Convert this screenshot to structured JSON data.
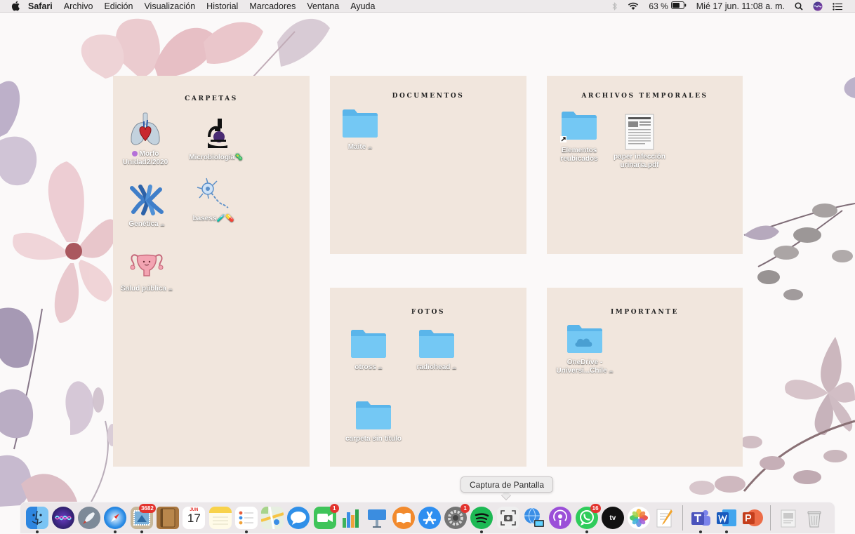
{
  "menubar": {
    "app_name": "Safari",
    "items": [
      "Archivo",
      "Edición",
      "Visualización",
      "Historial",
      "Marcadores",
      "Ventana",
      "Ayuda"
    ],
    "battery_percent": "63 %",
    "datetime": "Mié 17 jun.  11:08 a. m.",
    "status_icons": [
      "bluetooth-icon",
      "wifi-icon",
      "battery-icon",
      "spotlight-search-icon",
      "siri-icon",
      "control-center-icon"
    ]
  },
  "panels": {
    "carpetas": {
      "title": "CARPETAS",
      "items": [
        {
          "label_line1": "Morfo",
          "label_line2": "Unidad2/2020",
          "icon": "lungs-heart-icon",
          "tag_color": "#b470d8"
        },
        {
          "label": "Microbiología",
          "suffix": "🦠",
          "icon": "microscope-icon"
        },
        {
          "label": "Genética",
          "icon": "chromosome-icon",
          "cloud": "☁"
        },
        {
          "label": "basess",
          "suffix": "🧪💊",
          "icon": "neuron-icon"
        },
        {
          "label": "Salud pública",
          "icon": "uterus-icon",
          "cloud": "☁"
        }
      ]
    },
    "documentos": {
      "title": "DOCUMENTOS",
      "items": [
        {
          "label": "Maite",
          "icon": "folder-icon",
          "cloud": "☁"
        }
      ]
    },
    "archivos_temporales": {
      "title": "ARCHIVOS TEMPORALES",
      "items": [
        {
          "label_line1": "Elementos",
          "label_line2": "reubicados",
          "icon": "folder-alias-icon"
        },
        {
          "label_line1": "paper infección",
          "label_line2": "urinaria.pdf",
          "icon": "pdf-document-icon"
        }
      ]
    },
    "fotos": {
      "title": "FOTOS",
      "items": [
        {
          "label": "otross",
          "icon": "folder-icon",
          "cloud": "☁"
        },
        {
          "label": "radiohead",
          "icon": "folder-icon",
          "cloud": "☁"
        },
        {
          "label": "carpeta sin título",
          "icon": "folder-icon"
        }
      ]
    },
    "importante": {
      "title": "IMPORTANTE",
      "items": [
        {
          "label_line1": "OneDrive -",
          "label_line2": "Universi...Chile",
          "icon": "onedrive-folder-icon",
          "cloud": "☁"
        }
      ]
    }
  },
  "tooltip": {
    "text": "Captura de Pantalla"
  },
  "dock": {
    "calendar": {
      "month": "JUN",
      "day": "17"
    },
    "badges": {
      "contacts": "3682",
      "facetime": "1",
      "system_preferences": "1",
      "whatsapp": "16"
    },
    "tv_label": "tv",
    "apps": [
      "finder",
      "siri",
      "launchpad",
      "safari",
      "contacts",
      "notebook",
      "calendar",
      "notes",
      "reminders",
      "maps",
      "messages",
      "facetime",
      "numbers",
      "keynote",
      "books",
      "app-store",
      "system-preferences",
      "spotify",
      "screenshot",
      "network-utility",
      "podcasts",
      "whatsapp",
      "apple-tv",
      "photos",
      "pages",
      "teams",
      "word",
      "powerpoint",
      "preview",
      "trash"
    ]
  },
  "colors": {
    "panel_bg": "#f1e6dd",
    "folder_blue": "#6cc4f2",
    "label_white": "#ffffff",
    "menubar_bg": "#ece9ea"
  }
}
